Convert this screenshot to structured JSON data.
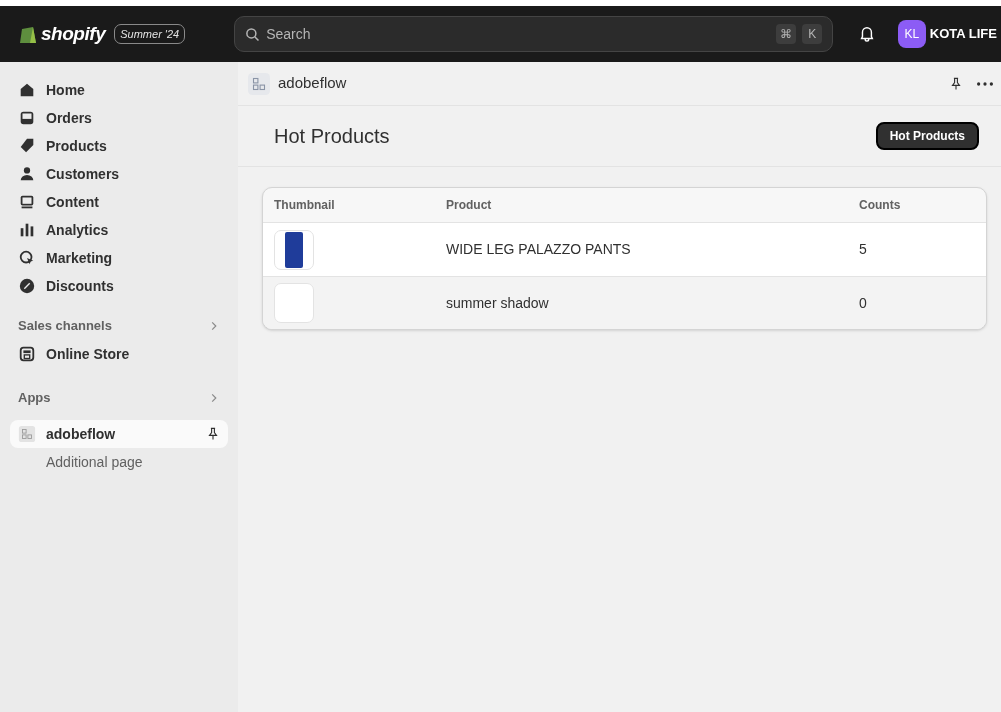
{
  "topbar": {
    "logo": "shopify",
    "badge": "Summer '24",
    "search": {
      "placeholder": "Search",
      "keys": [
        "⌘",
        "K"
      ]
    },
    "avatar": "KL",
    "store": "KOTA LIFE"
  },
  "sidebar": {
    "items": [
      {
        "label": "Home",
        "selected": false
      },
      {
        "label": "Orders",
        "selected": false
      },
      {
        "label": "Products",
        "selected": false
      },
      {
        "label": "Customers",
        "selected": false
      },
      {
        "label": "Content",
        "selected": false
      },
      {
        "label": "Analytics",
        "selected": false
      },
      {
        "label": "Marketing",
        "selected": false
      },
      {
        "label": "Discounts",
        "selected": false
      }
    ],
    "sales_channels": {
      "title": "Sales channels",
      "items": [
        {
          "label": "Online Store",
          "selected": false
        }
      ]
    },
    "apps": {
      "title": "Apps",
      "items": [
        {
          "label": "adobeflow",
          "selected": true,
          "children": [
            {
              "label": "Additional page",
              "selected": false
            }
          ]
        }
      ]
    }
  },
  "app_header": {
    "title": "adobeflow"
  },
  "page": {
    "title": "Hot Products",
    "button": "Hot Products"
  },
  "table": {
    "columns": [
      "Thumbnail",
      "Product",
      "Counts"
    ],
    "rows": [
      {
        "has_image": true,
        "highlighted": true,
        "product": "WIDE LEG PALAZZO PANTS",
        "count": "5"
      },
      {
        "has_image": false,
        "highlighted": false,
        "product": "summer shadow",
        "count": "0"
      }
    ]
  }
}
